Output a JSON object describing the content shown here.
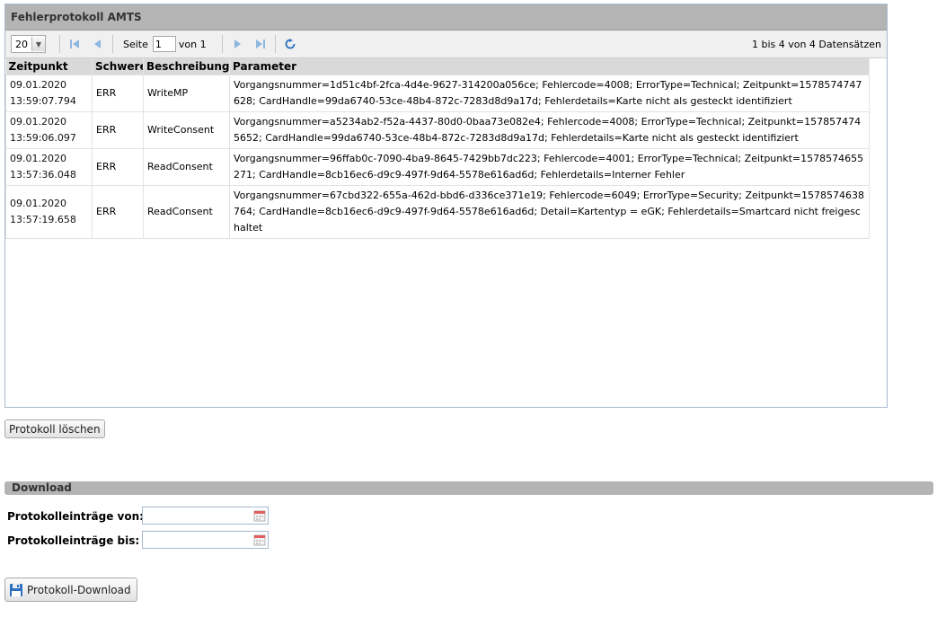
{
  "panel": {
    "title": "Fehlerprotokoll AMTS",
    "toolbar": {
      "page_size": "20",
      "page_label": "Seite",
      "page_value": "1",
      "of_label": "von 1",
      "record_count": "1 bis 4 von 4 Datensätzen"
    },
    "columns": [
      "Zeitpunkt",
      "Schwere",
      "Beschreibung",
      "Parameter"
    ],
    "rows": [
      {
        "date": "09.01.2020",
        "time": "13:59:07.794",
        "severity": "ERR",
        "description": "WriteMP",
        "parameter": "Vorgangsnummer=1d51c4bf-2fca-4d4e-9627-314200a056ce; Fehlercode=4008; ErrorType=Technical; Zeitpunkt=1578574747628; CardHandle=99da6740-53ce-48b4-872c-7283d8d9a17d; Fehlerdetails=Karte nicht als gesteckt identifiziert"
      },
      {
        "date": "09.01.2020",
        "time": "13:59:06.097",
        "severity": "ERR",
        "description": "WriteConsent",
        "parameter": "Vorgangsnummer=a5234ab2-f52a-4437-80d0-0baa73e082e4; Fehlercode=4008; ErrorType=Technical; Zeitpunkt=1578574745652; CardHandle=99da6740-53ce-48b4-872c-7283d8d9a17d; Fehlerdetails=Karte nicht als gesteckt identifiziert"
      },
      {
        "date": "09.01.2020",
        "time": "13:57:36.048",
        "severity": "ERR",
        "description": "ReadConsent",
        "parameter": "Vorgangsnummer=96ffab0c-7090-4ba9-8645-7429bb7dc223; Fehlercode=4001; ErrorType=Technical; Zeitpunkt=1578574655271; CardHandle=8cb16ec6-d9c9-497f-9d64-5578e616ad6d; Fehlerdetails=Interner Fehler"
      },
      {
        "date": "09.01.2020",
        "time": "13:57:19.658",
        "severity": "ERR",
        "description": "ReadConsent",
        "parameter": "Vorgangsnummer=67cbd322-655a-462d-bbd6-d336ce371e19; Fehlercode=6049; ErrorType=Security; Zeitpunkt=1578574638764; CardHandle=8cb16ec6-d9c9-497f-9d64-5578e616ad6d; Detail=Kartentyp = eGK; Fehlerdetails=Smartcard nicht freigeschaltet"
      }
    ]
  },
  "delete_button": "Protokoll löschen",
  "download": {
    "title": "Download",
    "from_label": "Protokolleinträge von:",
    "to_label": "Protokolleinträge bis:",
    "from_value": "",
    "to_value": "",
    "button": "Protokoll-Download"
  },
  "colors": {
    "header_gray": "#b4b4b4",
    "nav_icon_blue": "#5b9bd5",
    "refresh_blue": "#2f72c4"
  }
}
